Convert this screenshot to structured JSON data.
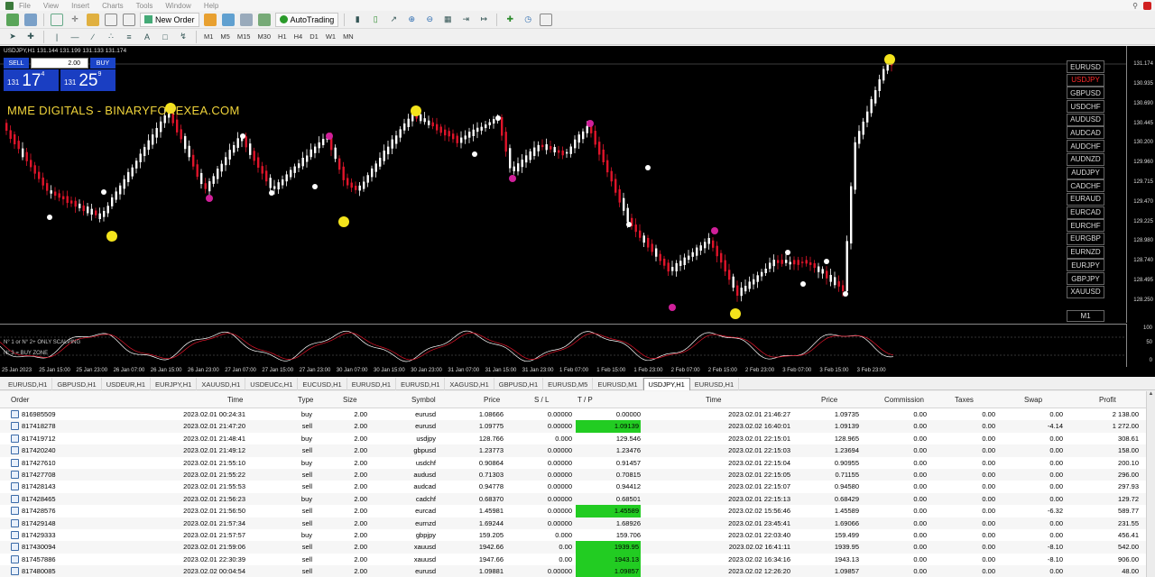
{
  "menu": {
    "items": [
      "File",
      "View",
      "Insert",
      "Charts",
      "Tools",
      "Window",
      "Help"
    ]
  },
  "toolbar": {
    "new_order_label": "New Order",
    "autotrading_label": "AutoTrading",
    "timeframes": [
      "M1",
      "M5",
      "M15",
      "M30",
      "H1",
      "H4",
      "D1",
      "W1",
      "MN"
    ]
  },
  "chart": {
    "title": "USDJPY,H1  131.144 131.199 131.133 131.174",
    "watermark": "MME DIGITALS - BINARYFOREXEA.COM",
    "lot": "2.00",
    "sell_label": "SELL",
    "buy_label": "BUY",
    "sell_price": {
      "prefix": "131",
      "big": "17",
      "sup": "4"
    },
    "buy_price": {
      "prefix": "131",
      "big": "25",
      "sup": "9"
    },
    "timeframe_label": "M1",
    "price_labels": [
      "131.174",
      "130.935",
      "130.690",
      "130.445",
      "130.200",
      "129.960",
      "129.715",
      "129.470",
      "129.225",
      "128.980",
      "128.740",
      "128.495",
      "128.250"
    ],
    "symbols": [
      "EURUSD",
      "USDJPY",
      "GBPUSD",
      "USDCHF",
      "AUDUSD",
      "AUDCAD",
      "AUDCHF",
      "AUDNZD",
      "AUDJPY",
      "CADCHF",
      "EURAUD",
      "EURCAD",
      "EURCHF",
      "EURGBP",
      "EURNZD",
      "EURJPY",
      "GBPJPY",
      "XAUUSD"
    ],
    "active_symbol": "USDJPY",
    "osc_lines": [
      "N° 1 or N° 2+ ONLY SCALPING",
      "N° 3 = BUY ZONE"
    ],
    "osc_levels": [
      "100",
      "50",
      "0"
    ],
    "time_labels": [
      "25 Jan 2023",
      "25 Jan 15:00",
      "25 Jan 23:00",
      "26 Jan 07:00",
      "26 Jan 15:00",
      "26 Jan 23:00",
      "27 Jan 07:00",
      "27 Jan 15:00",
      "27 Jan 23:00",
      "30 Jan 07:00",
      "30 Jan 15:00",
      "30 Jan 23:00",
      "31 Jan 07:00",
      "31 Jan 15:00",
      "31 Jan 23:00",
      "1 Feb 07:00",
      "1 Feb 15:00",
      "1 Feb 23:00",
      "2 Feb 07:00",
      "2 Feb 15:00",
      "2 Feb 23:00",
      "3 Feb 07:00",
      "3 Feb 15:00",
      "3 Feb 23:00"
    ],
    "colors": {
      "up": "#ffffff",
      "down": "#e0142a",
      "marker_yellow": "#f4e41c",
      "marker_magenta": "#d0209a",
      "background": "#000000"
    }
  },
  "chart_tabs": [
    "EURUSD,H1",
    "GBPUSD,H1",
    "USDEUR,H1",
    "EURJPY,H1",
    "XAUUSD,H1",
    "USDEUCc,H1",
    "EUCUSD,H1",
    "EURUSD,H1",
    "EURUSD,H1",
    "XAGUSD,H1",
    "GBPUSD,H1",
    "EURUSD,M5",
    "EURUSD,M1",
    "USDJPY,H1",
    "EURUSD,H1"
  ],
  "active_tab": "USDJPY,H1",
  "terminal": {
    "columns": [
      "Order",
      "Time",
      "Type",
      "Size",
      "Symbol",
      "Price",
      "S / L",
      "T / P",
      "Time",
      "Price",
      "Commission",
      "Taxes",
      "Swap",
      "Profit"
    ],
    "rows": [
      [
        "816985509",
        "2023.02.01 00:24:31",
        "buy",
        "2.00",
        "eurusd",
        "1.08666",
        "0.00000",
        "0.00000",
        "2023.02.01 21:46:27",
        "1.09735",
        "0.00",
        "0.00",
        "0.00",
        "2 138.00"
      ],
      [
        "817418278",
        "2023.02.01 21:47:20",
        "sell",
        "2.00",
        "eurusd",
        "1.09775",
        "0.00000",
        "1.09139",
        "2023.02.02 16:40:01",
        "1.09139",
        "0.00",
        "0.00",
        "-4.14",
        "1 272.00"
      ],
      [
        "817419712",
        "2023.02.01 21:48:41",
        "buy",
        "2.00",
        "usdjpy",
        "128.766",
        "0.000",
        "129.546",
        "2023.02.01 22:15:01",
        "128.965",
        "0.00",
        "0.00",
        "0.00",
        "308.61"
      ],
      [
        "817420240",
        "2023.02.01 21:49:12",
        "sell",
        "2.00",
        "gbpusd",
        "1.23773",
        "0.00000",
        "1.23476",
        "2023.02.01 22:15:03",
        "1.23694",
        "0.00",
        "0.00",
        "0.00",
        "158.00"
      ],
      [
        "817427610",
        "2023.02.01 21:55:10",
        "buy",
        "2.00",
        "usdchf",
        "0.90864",
        "0.00000",
        "0.91457",
        "2023.02.01 22:15:04",
        "0.90955",
        "0.00",
        "0.00",
        "0.00",
        "200.10"
      ],
      [
        "817427708",
        "2023.02.01 21:55:22",
        "sell",
        "2.00",
        "audusd",
        "0.71303",
        "0.00000",
        "0.70815",
        "2023.02.01 22:15:05",
        "0.71155",
        "0.00",
        "0.00",
        "0.00",
        "296.00"
      ],
      [
        "817428143",
        "2023.02.01 21:55:53",
        "sell",
        "2.00",
        "audcad",
        "0.94778",
        "0.00000",
        "0.94412",
        "2023.02.01 22:15:07",
        "0.94580",
        "0.00",
        "0.00",
        "0.00",
        "297.93"
      ],
      [
        "817428465",
        "2023.02.01 21:56:23",
        "buy",
        "2.00",
        "cadchf",
        "0.68370",
        "0.00000",
        "0.68501",
        "2023.02.01 22:15:13",
        "0.68429",
        "0.00",
        "0.00",
        "0.00",
        "129.72"
      ],
      [
        "817428576",
        "2023.02.01 21:56:50",
        "sell",
        "2.00",
        "eurcad",
        "1.45981",
        "0.00000",
        "1.45589",
        "2023.02.02 15:56:46",
        "1.45589",
        "0.00",
        "0.00",
        "-6.32",
        "589.77"
      ],
      [
        "817429148",
        "2023.02.01 21:57:34",
        "sell",
        "2.00",
        "eurnzd",
        "1.69244",
        "0.00000",
        "1.68926",
        "2023.02.01 23:45:41",
        "1.69066",
        "0.00",
        "0.00",
        "0.00",
        "231.55"
      ],
      [
        "817429333",
        "2023.02.01 21:57:57",
        "buy",
        "2.00",
        "gbpjpy",
        "159.205",
        "0.000",
        "159.706",
        "2023.02.01 22:03:40",
        "159.499",
        "0.00",
        "0.00",
        "0.00",
        "456.41"
      ],
      [
        "817430094",
        "2023.02.01 21:59:06",
        "sell",
        "2.00",
        "xauusd",
        "1942.66",
        "0.00",
        "1939.95",
        "2023.02.02 16:41:11",
        "1939.95",
        "0.00",
        "0.00",
        "-8.10",
        "542.00"
      ],
      [
        "817457886",
        "2023.02.01 22:30:39",
        "sell",
        "2.00",
        "xauusd",
        "1947.66",
        "0.00",
        "1943.13",
        "2023.02.02 16:34:16",
        "1943.13",
        "0.00",
        "0.00",
        "-8.10",
        "906.00"
      ],
      [
        "817480085",
        "2023.02.02 00:04:54",
        "sell",
        "2.00",
        "eurusd",
        "1.09881",
        "0.00000",
        "1.09857",
        "2023.02.02 12:26:20",
        "1.09857",
        "0.00",
        "0.00",
        "0.00",
        "48.00"
      ]
    ],
    "tp_highlighted_rows": [
      1,
      8,
      11,
      12,
      13
    ],
    "highlight_color": "#22cc22"
  }
}
